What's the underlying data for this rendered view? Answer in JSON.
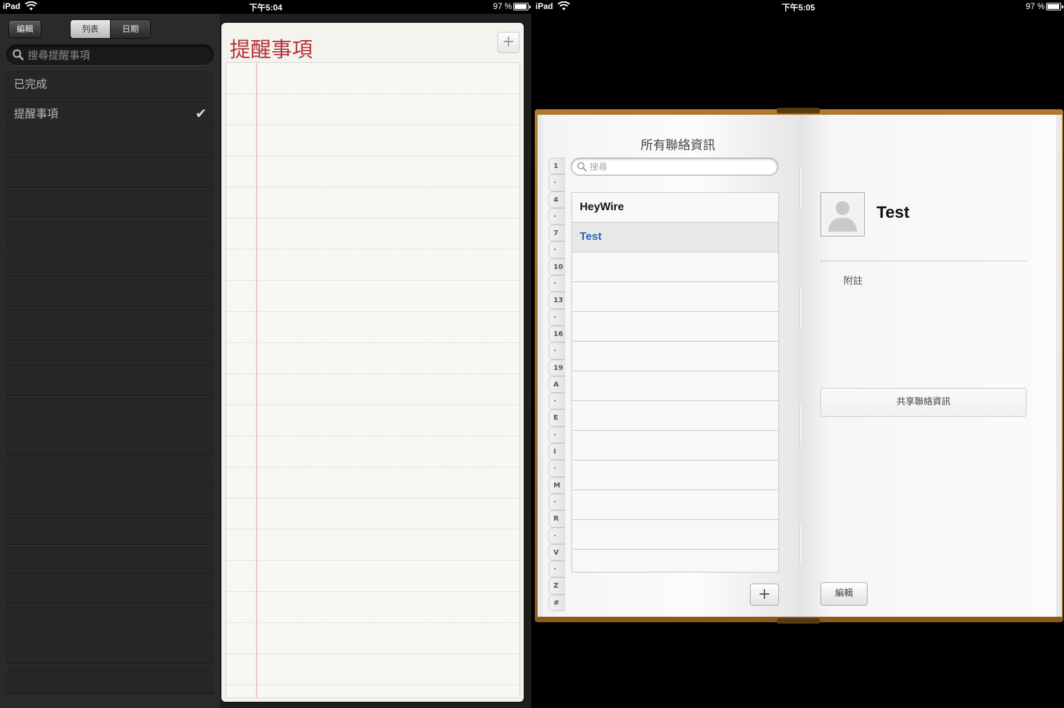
{
  "left_status": {
    "device": "iPad",
    "time": "下午5:04",
    "battery": "97 %",
    "battery_level": 0.97
  },
  "right_status": {
    "device": "iPad",
    "time": "下午5:05",
    "battery": "97 %",
    "battery_level": 0.97
  },
  "reminders": {
    "edit_label": "編輯",
    "view_tabs": [
      {
        "label": "列表",
        "active": true
      },
      {
        "label": "日期",
        "active": false
      }
    ],
    "search_placeholder": "搜尋提醒事項",
    "lists": [
      {
        "label": "已完成",
        "checked": false
      },
      {
        "label": "提醒事項",
        "checked": true
      }
    ],
    "empty_rows": 19,
    "title": "提醒事項",
    "add_label": "+",
    "colors": {
      "title": "#b5323c",
      "margin_line": "#f0c4c4"
    }
  },
  "contacts": {
    "title": "所有聯絡資訊",
    "search_placeholder": "搜尋",
    "index": [
      "1",
      "·",
      "4",
      "·",
      "7",
      "·",
      "10",
      "·",
      "13",
      "·",
      "16",
      "·",
      "19",
      "A",
      "·",
      "E",
      "·",
      "I",
      "·",
      "M",
      "·",
      "R",
      "·",
      "V",
      "·",
      "Z",
      "#"
    ],
    "list": [
      {
        "name": "HeyWire",
        "selected": false
      },
      {
        "name": "Test",
        "selected": true
      }
    ],
    "empty_rows": 10,
    "add_label": "+",
    "selected_name": "Test",
    "notes_label": "附註",
    "share_label": "共享聯絡資訊",
    "edit_label": "編輯",
    "colors": {
      "selected_text": "#2a64b8",
      "book_cover": "#b07a2b"
    }
  }
}
